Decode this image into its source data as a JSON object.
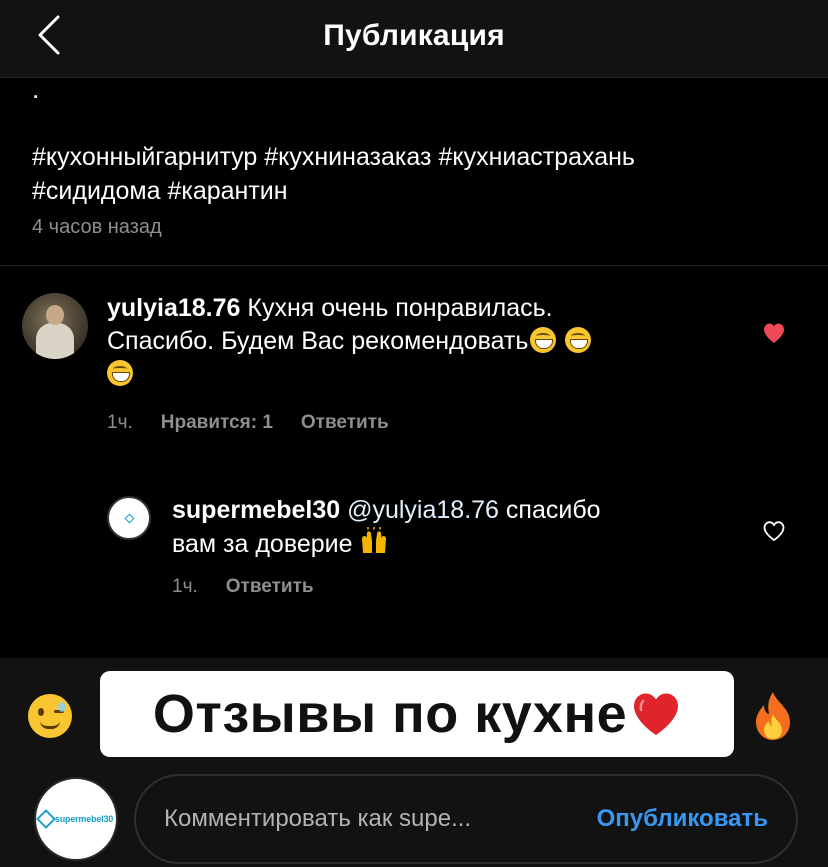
{
  "header": {
    "title": "Публикация",
    "back_icon": "chevron-left-icon"
  },
  "post": {
    "dot": ".",
    "caption_line1": "#кухонныйгарнитур #кухниназаказ #кухниастрахань",
    "caption_line2": "#сидидома #карантин",
    "time": "4 часов назад"
  },
  "comments": [
    {
      "username": "yulyia18.76",
      "text_line1": "Кухня очень понравилась.",
      "text_line2": "Спасибо. Будем Вас рекомендовать",
      "emojis": [
        "grinning-face-icon",
        "grinning-face-icon",
        "grinning-face-icon"
      ],
      "time": "1ч.",
      "likes": "Нравится: 1",
      "reply": "Ответить",
      "liked": true,
      "heart_color": "#ed4956"
    },
    {
      "username": "supermebel30",
      "mention": "@yulyia18.76",
      "text_line1": "спасибо",
      "text_line2": "вам за доверие",
      "emoji": "raising-hands-icon",
      "time": "1ч.",
      "reply": "Ответить",
      "liked": false
    }
  ],
  "overlay": {
    "banner_text": "Отзывы по кухне",
    "left_emoji": "winking-face-icon",
    "right_emoji": "fire-icon",
    "heart_emoji": "red-heart-icon"
  },
  "composer": {
    "avatar_text": "supermebel30",
    "placeholder": "Комментировать как supe...",
    "publish_label": "Опубликовать",
    "accent": "#3897f0"
  }
}
